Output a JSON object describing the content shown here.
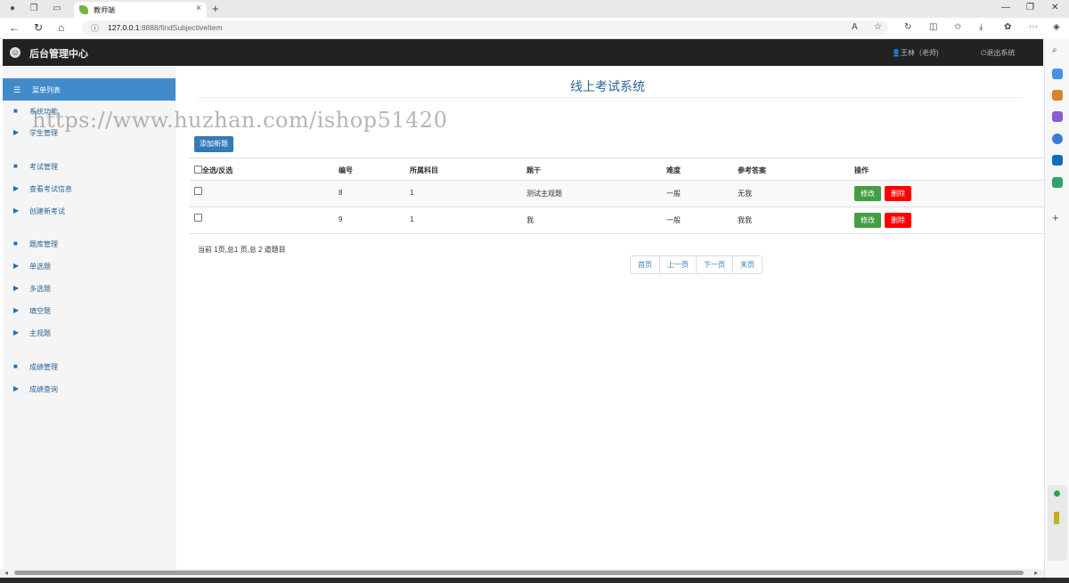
{
  "browser": {
    "tab_title": "教师端",
    "tab_close": "×",
    "new_tab": "+",
    "url_host": "127.0.0.1",
    "url_path": ":8888/findSubjectiveItem",
    "window_buttons": [
      "—",
      "❐",
      "✕"
    ]
  },
  "app": {
    "brand": "后台管理中心",
    "user_label": "王林（老师)",
    "logout_label": "退出系统"
  },
  "sidebar": {
    "menu_title": "菜单列表",
    "items": [
      {
        "label": "系统功能",
        "type": "group"
      },
      {
        "label": "学生管理",
        "type": "item"
      },
      {
        "label": "考试管理",
        "type": "group"
      },
      {
        "label": "查看考试信息",
        "type": "item"
      },
      {
        "label": "创建新考试",
        "type": "item"
      },
      {
        "label": "题库管理",
        "type": "group"
      },
      {
        "label": "单选题",
        "type": "item"
      },
      {
        "label": "多选题",
        "type": "item"
      },
      {
        "label": "填空题",
        "type": "item"
      },
      {
        "label": "主观题",
        "type": "item"
      },
      {
        "label": "成绩管理",
        "type": "group"
      },
      {
        "label": "成绩查询",
        "type": "item"
      }
    ]
  },
  "main": {
    "title": "线上考试系统",
    "watermark": "https://www.huzhan.com/ishop51420",
    "add_button": "添加新题",
    "table": {
      "headers": [
        "全选/反选",
        "编号",
        "所属科目",
        "题干",
        "难度",
        "参考答案",
        "操作"
      ],
      "rows": [
        {
          "id": "8",
          "subject": "1",
          "stem": "测试主观题",
          "difficulty": "一般",
          "answer": "无我"
        },
        {
          "id": "9",
          "subject": "1",
          "stem": "我",
          "difficulty": "一般",
          "answer": "我我"
        }
      ],
      "edit_label": "修改",
      "delete_label": "删除"
    },
    "page_info": "当前 1页,总1 页,总 2 道题目",
    "pager": [
      "首页",
      "上一页",
      "下一页",
      "末页"
    ]
  },
  "colors": {
    "header_bg": "#222222",
    "accent": "#428bca",
    "edit_green": "#449d44",
    "delete_red": "#ff0000",
    "title_blue": "#2a6496"
  }
}
